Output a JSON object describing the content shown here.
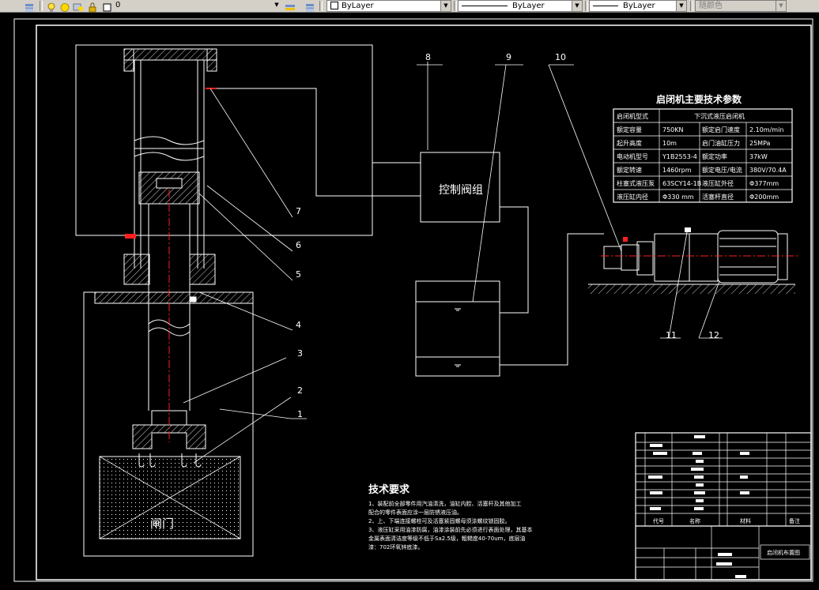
{
  "toolbar": {
    "layer_value": "0",
    "color_value": "ByLayer",
    "linetype_value": "ByLayer",
    "lineweight_value": "ByLayer",
    "plotstyle_value": "随颜色"
  },
  "drawing": {
    "callouts": [
      "1",
      "2",
      "3",
      "4",
      "5",
      "6",
      "7",
      "8",
      "9",
      "10",
      "11",
      "12"
    ],
    "valve_label": "控制阀组",
    "gate_label": "闸门",
    "params_table": {
      "title": "启闭机主要技术参数",
      "header_left": "启闭机型式",
      "header_right": "下沉式液压启闭机",
      "rows": [
        [
          "额定容量",
          "750KN",
          "额定启门速度",
          "2.10m/min"
        ],
        [
          "起升高度",
          "10m",
          "启门油缸压力",
          "25MPa"
        ],
        [
          "电动机型号",
          "Y1B2553-4",
          "额定功率",
          "37kW"
        ],
        [
          "额定转速",
          "1460rpm",
          "额定电压/电流",
          "380V/70.4A"
        ],
        [
          "柱塞式液压泵",
          "63SCY14-1B",
          "液压缸外径",
          "Φ377mm"
        ],
        [
          "液压缸内径",
          "Φ330 mm",
          "活塞杆直径",
          "Φ200mm"
        ]
      ]
    },
    "tech_req": {
      "title": "技术要求",
      "lines": [
        "1、装配前全部零件用汽油清洗，油缸内腔、活塞杆及其他加工",
        "配合的零件表面应涂一层防锈液压油。",
        "2、上、下端连接螺栓可及活塞紧固螺母须涂螺纹锁固胶。",
        "3、液压缸采用油漆防腐，油漆涂装前先必须进行表面处理，其基本",
        "金属表面清洁度等级不低于Sa2.5级，粗糙度40-70um，底层油",
        "漆：702环氧锌底漆。"
      ]
    },
    "title_block": {
      "col_code": "代号",
      "col_name": "名称",
      "col_material": "材料",
      "col_note": "备注",
      "drawing_title": "启闭机布置图"
    }
  }
}
